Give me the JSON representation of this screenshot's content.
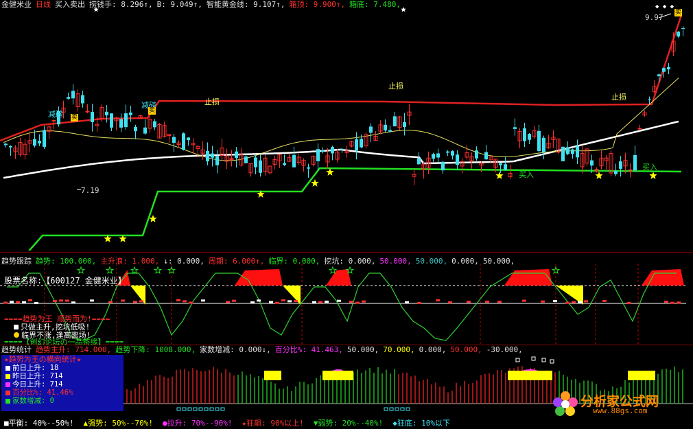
{
  "colors": {
    "red": "#ff2020",
    "green": "#22e022",
    "white": "#ffffff",
    "cyan": "#40e0f0",
    "yellow": "#ffff00",
    "magenta": "#ff30ff",
    "darkred": "#8a0000",
    "gold": "#ffd000"
  },
  "main": {
    "header": [
      {
        "text": "金健米业",
        "color": "#e0e0e0"
      },
      {
        "text": "日线",
        "color": "#ff3030"
      },
      {
        "text": "买入卖出",
        "color": "#e0e0e0"
      },
      {
        "text": "捞钱手: 8.296↑,",
        "color": "#e0e0e0"
      },
      {
        "text": "B: 9.049↑,",
        "color": "#e0e0e0"
      },
      {
        "text": "智能黄金线: 9.107↑,",
        "color": "#e0e0e0"
      },
      {
        "text": "箱顶: 9.900↑,",
        "color": "#ff3030"
      },
      {
        "text": "箱底: 7.480,",
        "color": "#22e022"
      }
    ],
    "annotations": {
      "reduce_label": "减磅",
      "stop_label": "止损",
      "buy_label": "买入",
      "high_value": "9.97",
      "low_value": "7.19",
      "top_stars": "◆ ◆ ◆"
    },
    "flag_label": "卖"
  },
  "trend": {
    "header": [
      {
        "text": "趋势跟踪",
        "color": "#e0e0e0"
      },
      {
        "text": "趋势: 100.000,",
        "color": "#22e022"
      },
      {
        "text": "主升浪: 1.000,",
        "color": "#ff3030"
      },
      {
        "text": "↓: 0.000,",
        "color": "#e0e0e0"
      },
      {
        "text": "周期: 6.000↑,",
        "color": "#ff3030"
      },
      {
        "text": "临界: 0.000,",
        "color": "#22e022"
      },
      {
        "text": "挖坑: 0.000,",
        "color": "#e0e0e0"
      },
      {
        "text": "50.000,",
        "color": "#ff30ff"
      },
      {
        "text": "50.000,",
        "color": "#40c0c0"
      },
      {
        "text": "0.000,",
        "color": "#e0e0e0"
      },
      {
        "text": "50.000,",
        "color": "#e0e0e0"
      }
    ],
    "stock_label": "股票名称:",
    "stock_name": "【600127 金健米业】",
    "slogan1": "====趋势为王 顺势而为!====",
    "slogan2": "只做主升,挖坑低吸!",
    "slogan3": "临界不涨,逢高离场!",
    "slogan4": "====【创幻论坛の一品茶缘】===="
  },
  "stats": {
    "header": [
      {
        "text": "趋势统计",
        "color": "#e0e0e0"
      },
      {
        "text": "趋势主升: 714.000,",
        "color": "#ff3030"
      },
      {
        "text": "趋势下降: 1008.000,",
        "color": "#22e022"
      },
      {
        "text": "家数增减: 0.000↓,",
        "color": "#e0e0e0"
      },
      {
        "text": "百分比%: 41.463,",
        "color": "#ff30ff"
      },
      {
        "text": "50.000,",
        "color": "#e0e0e0"
      },
      {
        "text": "70.000,",
        "color": "#ffff00"
      },
      {
        "text": "0.000,",
        "color": "#e0e0e0"
      },
      {
        "text": "50.000,",
        "color": "#ff3030"
      },
      {
        "text": "-30.000,",
        "color": "#e0e0e0"
      }
    ],
    "legend_title": "★趋势为王の横向统计★",
    "legend_rows": [
      {
        "label": "前日上升: 18",
        "color": "#ffffff",
        "sq": "#ffffff"
      },
      {
        "label": "昨日上升: 714",
        "color": "#ffffff",
        "sq": "#ffff00"
      },
      {
        "label": "今日上升: 714",
        "color": "#ffffff",
        "sq": "#ff30ff"
      },
      {
        "label": "百分比%: 41.46%",
        "color": "#ff3030",
        "sq": "#ff3030"
      },
      {
        "label": "家数增减: 0",
        "color": "#22e022",
        "sq": "#22e022"
      }
    ]
  },
  "bottom_legend": [
    {
      "text": "■平衡: 40%--50%!",
      "color": "#ffffff"
    },
    {
      "text": "▲强势: 50%--70%!",
      "color": "#ffff00"
    },
    {
      "text": "●拉升: 70%--90%!",
      "color": "#ff30ff"
    },
    {
      "text": "★狂飙: 90%以上!",
      "color": "#ff3030"
    },
    {
      "text": "▼弱势: 20%--40%!",
      "color": "#22e022"
    },
    {
      "text": "◆狂底: 10%以下",
      "color": "#40e0f0"
    }
  ],
  "watermark": {
    "name": "分析家公式网",
    "url": "www.88gs.com"
  },
  "chart_data": {
    "type": "candlestick",
    "ylim": [
      7.0,
      10.2
    ],
    "series": [
      {
        "name": "箱顶",
        "last": 9.9
      },
      {
        "name": "箱底",
        "last": 7.48
      },
      {
        "name": "捞钱手",
        "last": 8.296
      },
      {
        "name": "B",
        "last": 9.049
      },
      {
        "name": "智能黄金线",
        "last": 9.107
      }
    ],
    "high": 9.97,
    "low": 7.19
  }
}
